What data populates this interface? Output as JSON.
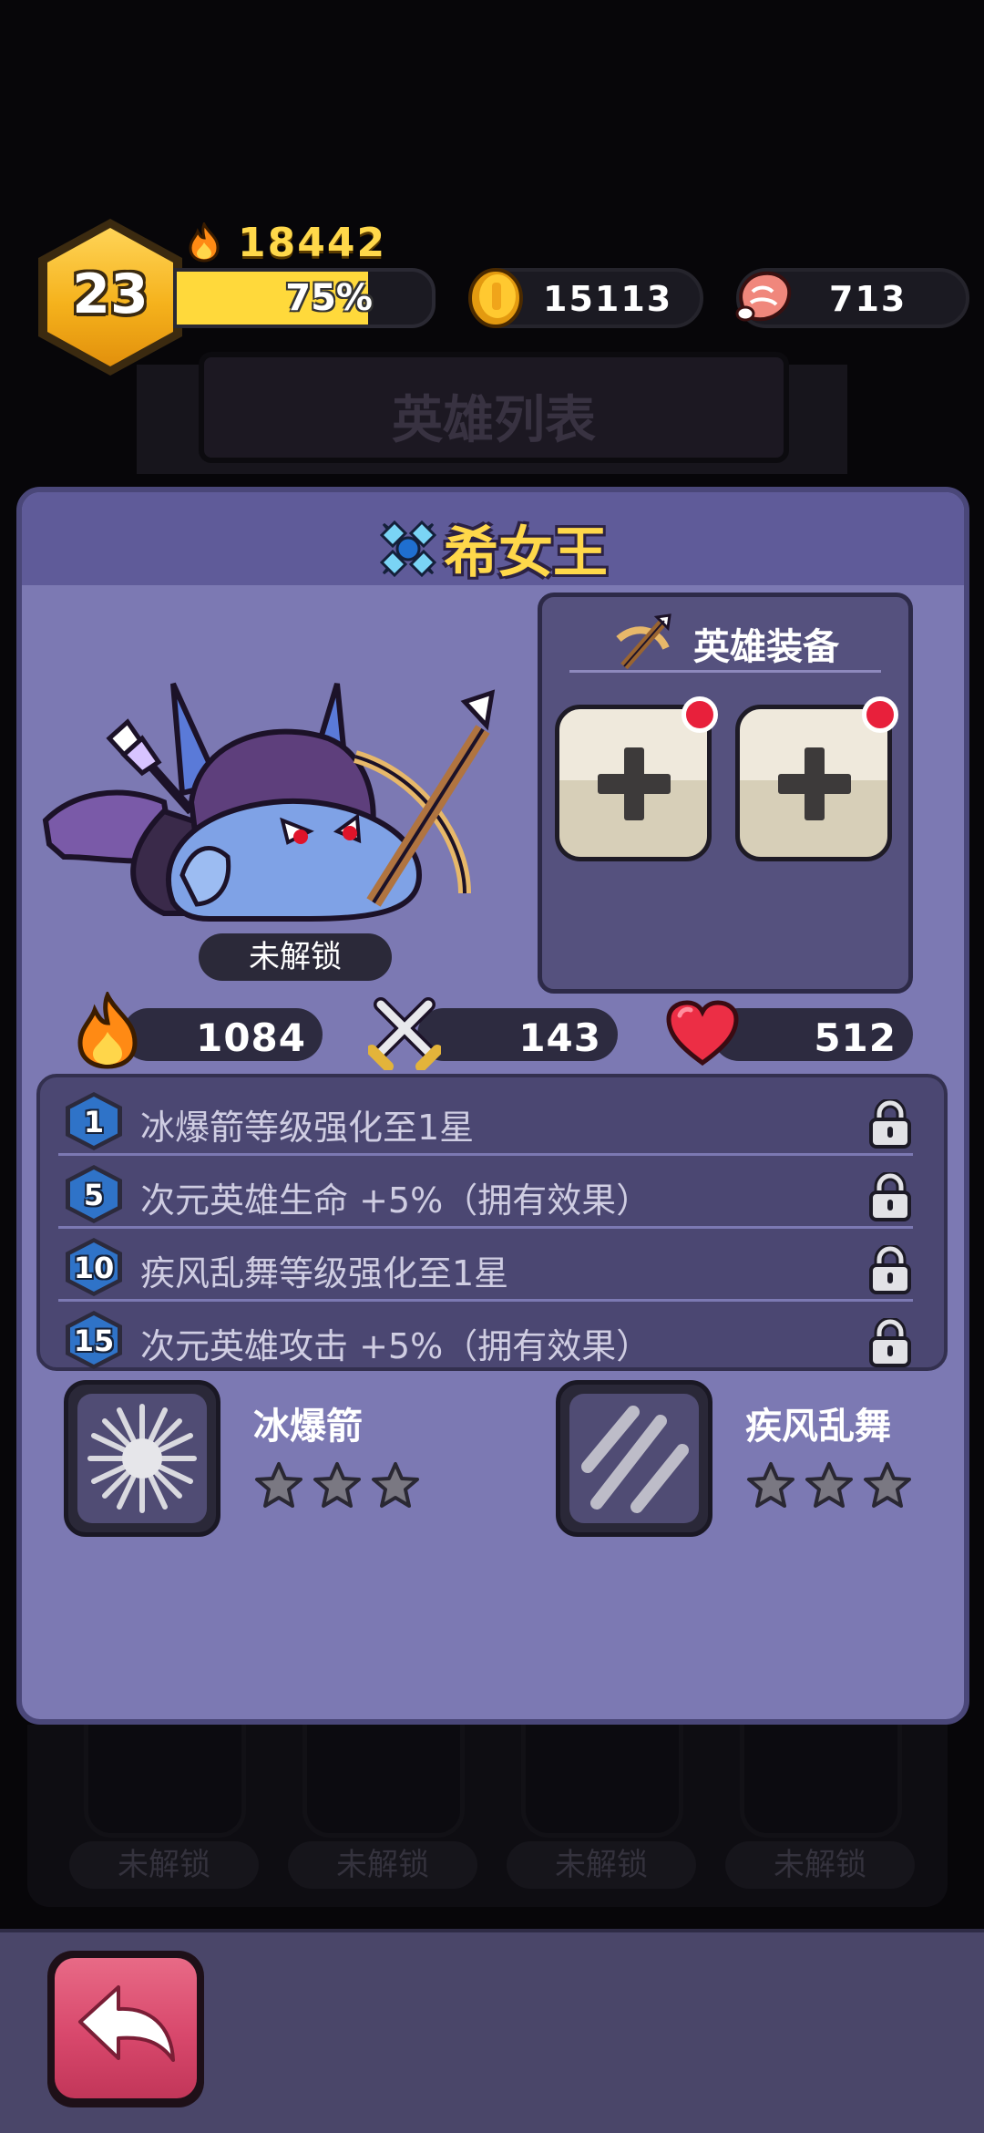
{
  "hud": {
    "level": "23",
    "power": "18442",
    "xp_percent_label": "75%",
    "xp_fraction": 0.75,
    "coins": "15113",
    "meat": "713"
  },
  "banner": {
    "title": "英雄列表"
  },
  "hero": {
    "name": "希女王",
    "status": "未解锁",
    "equipment_title": "英雄装备",
    "stats": {
      "power": "1084",
      "attack": "143",
      "health": "512"
    }
  },
  "perks": [
    {
      "level": "1",
      "text": "冰爆箭等级强化至1星"
    },
    {
      "level": "5",
      "text": "次元英雄生命  +5%（拥有效果）"
    },
    {
      "level": "10",
      "text": "疾风乱舞等级强化至1星"
    },
    {
      "level": "15",
      "text": "次元英雄攻击  +5%（拥有效果）"
    }
  ],
  "skills": [
    {
      "name": "冰爆箭",
      "stars": 3,
      "stars_filled": 0
    },
    {
      "name": "疾风乱舞",
      "stars": 3,
      "stars_filled": 0
    }
  ],
  "background_heroes": [
    {
      "status": "未解锁"
    },
    {
      "status": "未解锁"
    },
    {
      "status": "未解锁"
    },
    {
      "status": "未解锁"
    }
  ],
  "colors": {
    "gold": "#ffd84a",
    "panel": "#7c79b3",
    "panel_header": "#5f5b99",
    "alert_red": "#e8203b",
    "back_button": "#d8486c"
  }
}
